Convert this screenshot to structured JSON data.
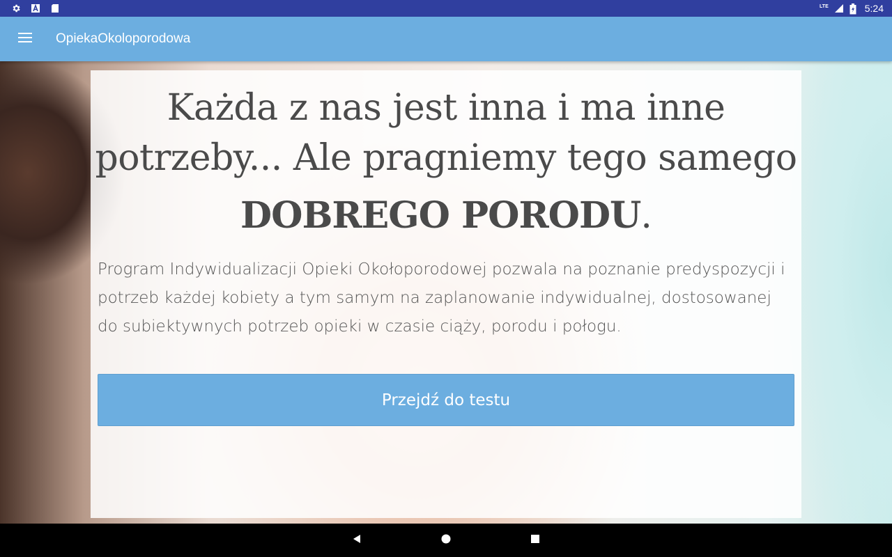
{
  "status_bar": {
    "time": "5:24",
    "network": "LTE",
    "icons": [
      "settings-icon",
      "a-notification-icon",
      "sd-card-icon",
      "signal-icon",
      "battery-charging-icon"
    ]
  },
  "app_bar": {
    "title": "OpiekaOkoloporodowa",
    "menu_icon": "hamburger-menu-icon",
    "color": "#6caee0"
  },
  "main": {
    "headline": "Każda z nas jest inna i ma inne potrzeby... Ale pragniemy tego samego",
    "headline_emphasis": "DOBREGO PORODU",
    "headline_emphasis_suffix": ".",
    "description": "Program Indywidualizacji Opieki Okołoporodowej pozwala na poznanie predyspozycji i potrzeb każdej kobiety a tym samym na zaplanowanie indywidualnej, dostosowanej do subiektywnych potrzeb opieki w czasie ciąży, porodu i połogu.",
    "cta_label": "Przejdź do testu",
    "cta_color": "#6caee0"
  },
  "nav_bar": {
    "buttons": [
      "back-icon",
      "home-icon",
      "recents-icon"
    ]
  }
}
